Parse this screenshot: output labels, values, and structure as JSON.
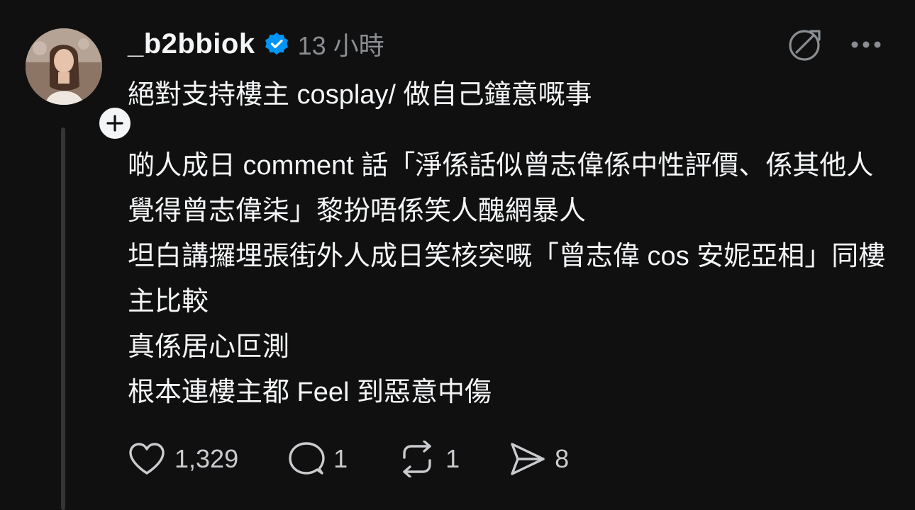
{
  "post": {
    "username": "_b2bbiok",
    "verified": true,
    "timestamp": "13 小時",
    "lines": [
      "絕對支持樓主 cosplay/ 做自己鐘意嘅事",
      "啲人成日 comment 話「淨係話似曾志偉係中性評價、係其他人覺得曾志偉柒」黎扮唔係笑人醜網暴人",
      "坦白講攞埋張街外人成日笑核突嘅「曾志偉 cos 安妮亞相」同樓主比較",
      "真係居心叵測",
      "根本連樓主都 Feel 到惡意中傷"
    ]
  },
  "actions": {
    "like_count": "1,329",
    "reply_count": "1",
    "repost_count": "1",
    "share_count": "8"
  },
  "icons": {
    "like": "heart-icon",
    "reply": "speech-bubble-icon",
    "repost": "repost-icon",
    "share": "send-icon",
    "more": "more-icon",
    "translate": "translate-icon",
    "follow": "plus-icon",
    "verified": "verified-badge-icon"
  },
  "colors": {
    "background": "#101010",
    "text": "#f3f5f7",
    "muted": "#8a8d91",
    "verified": "#0095f6",
    "thread_line": "#333638"
  }
}
